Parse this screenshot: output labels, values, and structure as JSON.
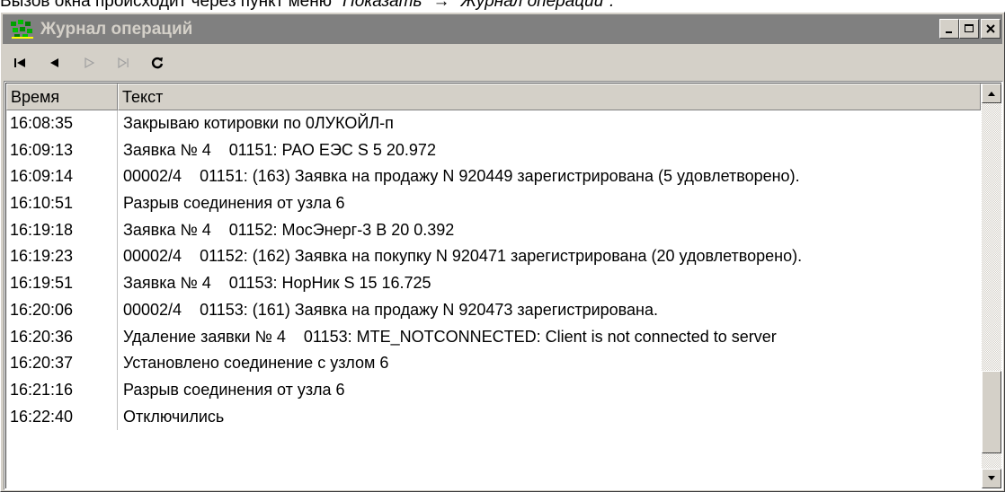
{
  "caption": {
    "prefix": "Вызов окна происходит через пункт меню ",
    "path": "\"Показать\" → \"Журнал операций\"."
  },
  "window": {
    "title": "Журнал операций",
    "controls": [
      "minimize-icon",
      "maximize-icon",
      "close-icon"
    ]
  },
  "toolbar": {
    "buttons": [
      {
        "icon": "first-icon",
        "enabled": true
      },
      {
        "icon": "prev-icon",
        "enabled": true
      },
      {
        "icon": "next-icon",
        "enabled": false
      },
      {
        "icon": "last-icon",
        "enabled": false
      },
      {
        "icon": "refresh-icon",
        "enabled": true
      }
    ]
  },
  "log": {
    "columns": [
      "Время",
      "Текст"
    ],
    "rows": [
      {
        "time": "16:08:35",
        "text": "Закрываю котировки по 0ЛУКОЙЛ-п"
      },
      {
        "time": "16:09:13",
        "text": "Заявка № 4    01151: РАО ЕЭС S 5 20.972"
      },
      {
        "time": "16:09:14",
        "text": "00002/4    01151: (163) Заявка на продажу N 920449 зарегистрирована (5 удовлетворено)."
      },
      {
        "time": "16:10:51",
        "text": "Разрыв соединения от узла 6"
      },
      {
        "time": "16:19:18",
        "text": "Заявка № 4    01152: МосЭнерг-3 B 20 0.392"
      },
      {
        "time": "16:19:23",
        "text": "00002/4    01152: (162) Заявка на покупку N 920471 зарегистрирована (20 удовлетворено)."
      },
      {
        "time": "16:19:51",
        "text": "Заявка № 4    01153: НорНик S 15 16.725"
      },
      {
        "time": "16:20:06",
        "text": "00002/4    01153: (161) Заявка на продажу N 920473 зарегистрирована."
      },
      {
        "time": "16:20:36",
        "text": "Удаление заявки № 4    01153: MTE_NOTCONNECTED: Client is not connected to server"
      },
      {
        "time": "16:20:37",
        "text": "Установлено соединение с узлом 6"
      },
      {
        "time": "16:21:16",
        "text": "Разрыв соединения от узла 6"
      },
      {
        "time": "16:22:40",
        "text": "Отключились"
      }
    ]
  },
  "colors": {
    "titlebar": "#808080",
    "title_text": "#d4d0c8",
    "face": "#d4d0c8"
  }
}
